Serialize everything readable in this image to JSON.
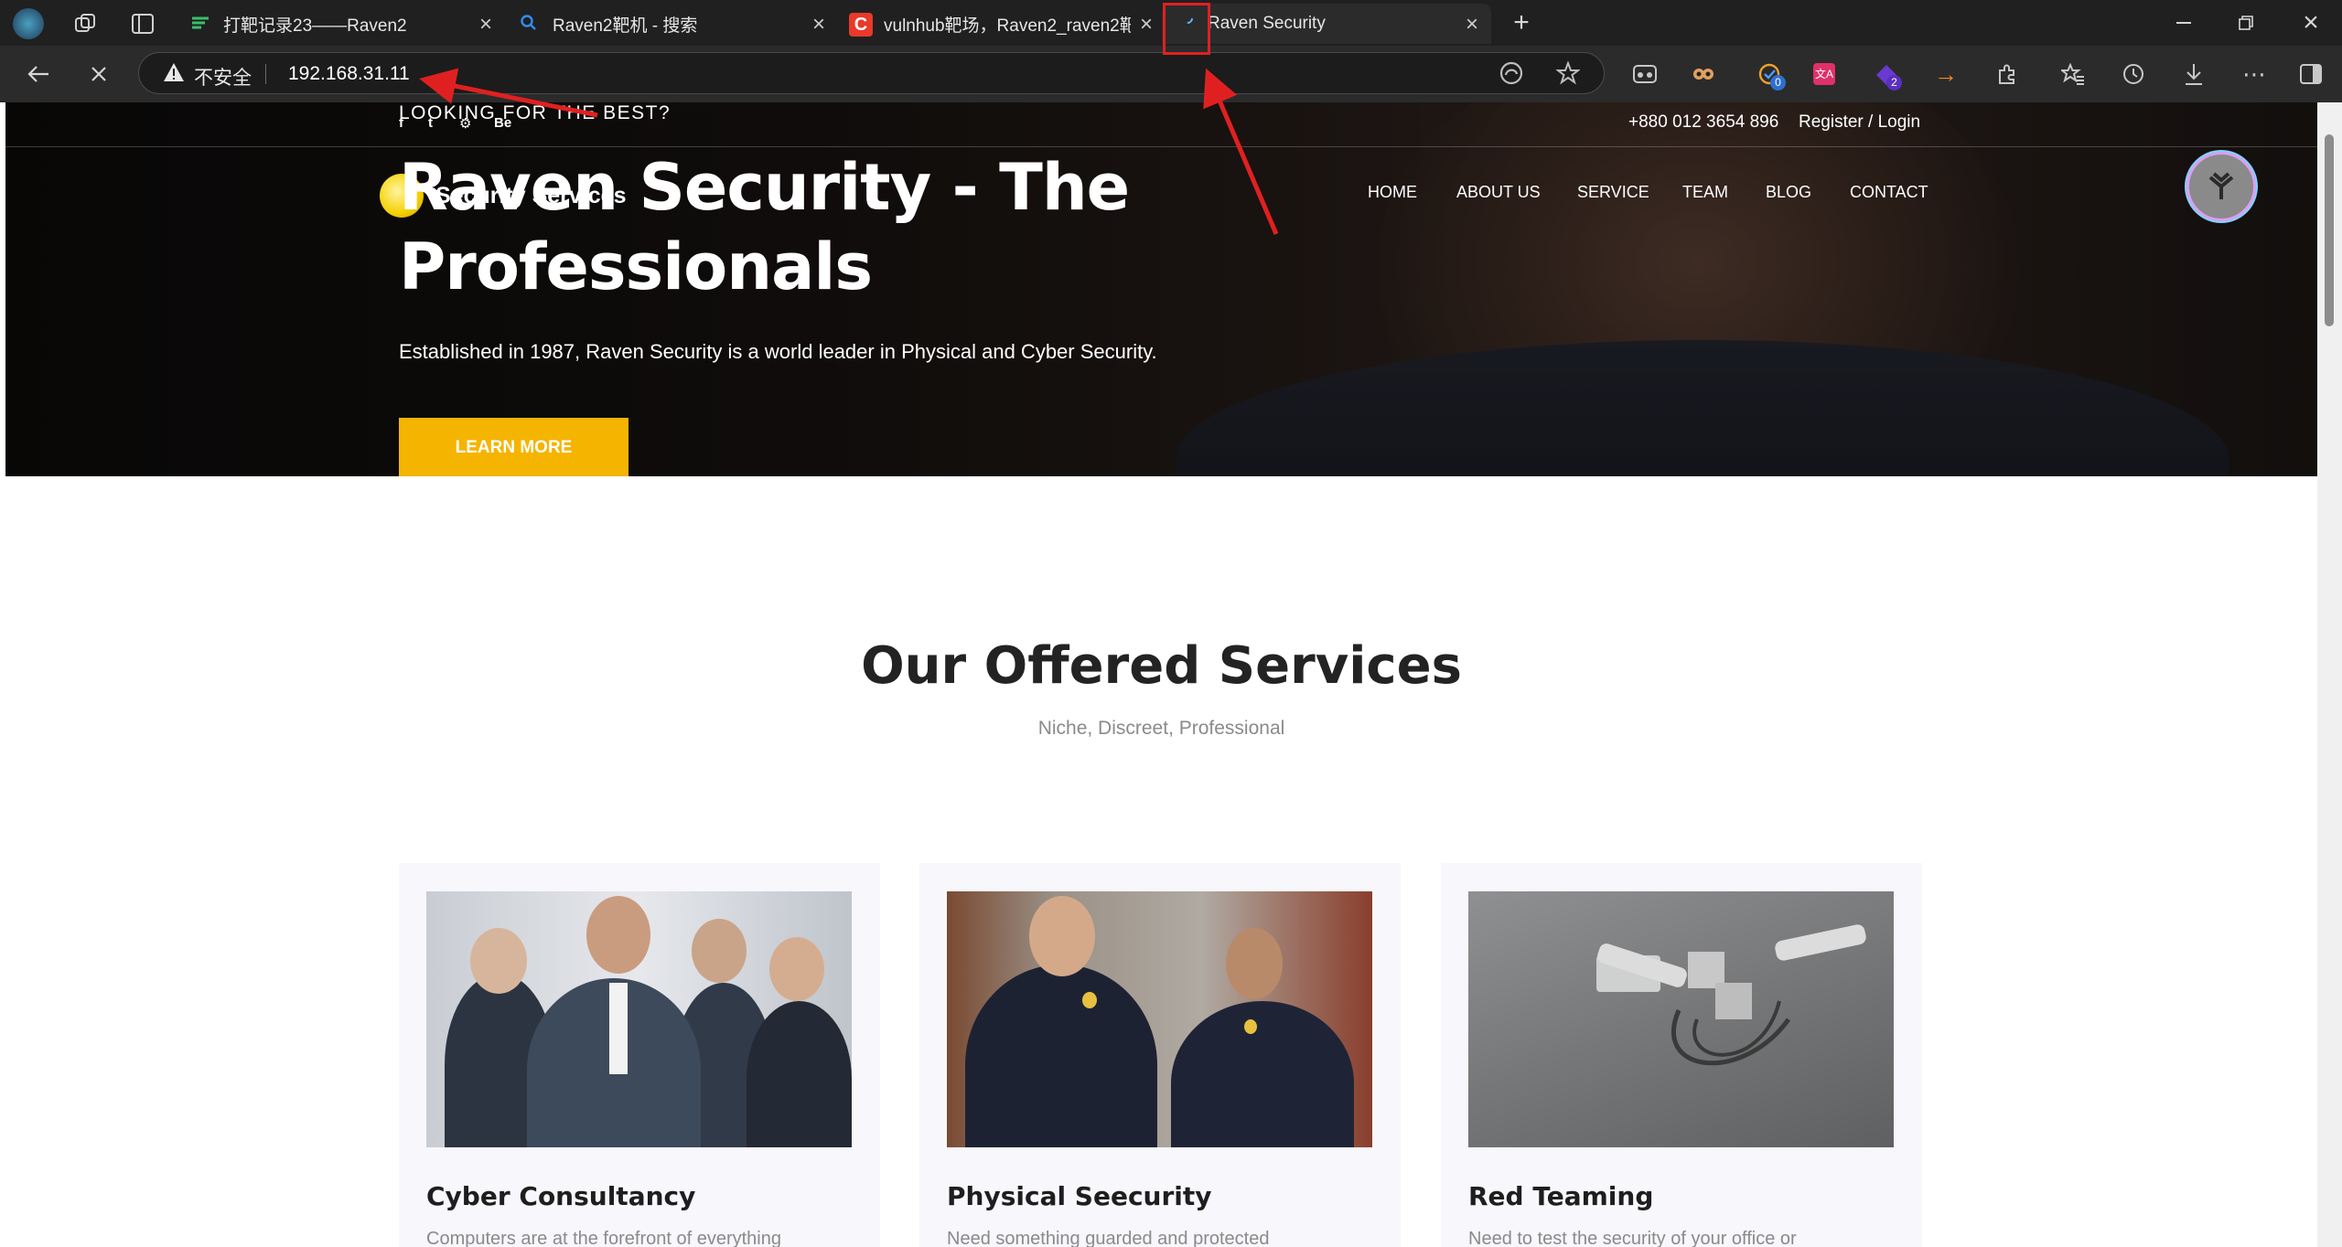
{
  "browser": {
    "tabs": [
      {
        "title": "打靶记录23——Raven2",
        "active": false
      },
      {
        "title": "Raven2靶机 - 搜索",
        "active": false
      },
      {
        "title": "vulnhub靶场，Raven2_raven2靶机",
        "active": false
      },
      {
        "title": "Raven Security",
        "active": true
      }
    ],
    "address_bar": {
      "security_label": "不安全",
      "url": "192.168.31.11"
    },
    "extension_badges": {
      "ext1": "0",
      "ext2": "2"
    },
    "colors": {
      "tabbar": "#202020",
      "toolbar": "#2b2b2b",
      "annotation_red": "#e02020"
    }
  },
  "site": {
    "header": {
      "tagline": "LOOKING FOR THE BEST?",
      "social": [
        "f",
        "t",
        "⚙",
        "Be"
      ],
      "phone": "+880 012 3654 896",
      "login": "Register / Login",
      "brand": "Security Services",
      "nav": [
        "HOME",
        "ABOUT US",
        "SERVICE",
        "TEAM",
        "BLOG",
        "CONTACT"
      ]
    },
    "hero": {
      "title": "Raven Security - The Professionals",
      "description": "Established in 1987, Raven Security is a world leader in Physical and Cyber Security.",
      "button": "LEARN MORE"
    },
    "services": {
      "title": "Our Offered Services",
      "subtitle": "Niche, Discreet, Professional",
      "cards": [
        {
          "title": "Cyber Consultancy",
          "text": "Computers are at the forefront of everything"
        },
        {
          "title": "Physical Seecurity",
          "text": "Need something guarded and protected"
        },
        {
          "title": "Red Teaming",
          "text": "Need to test the security of your office or"
        }
      ]
    },
    "colors": {
      "accent": "#f5b400",
      "heading": "#232323",
      "muted": "#8a8a8a",
      "card_bg": "#f7f7fc"
    }
  }
}
